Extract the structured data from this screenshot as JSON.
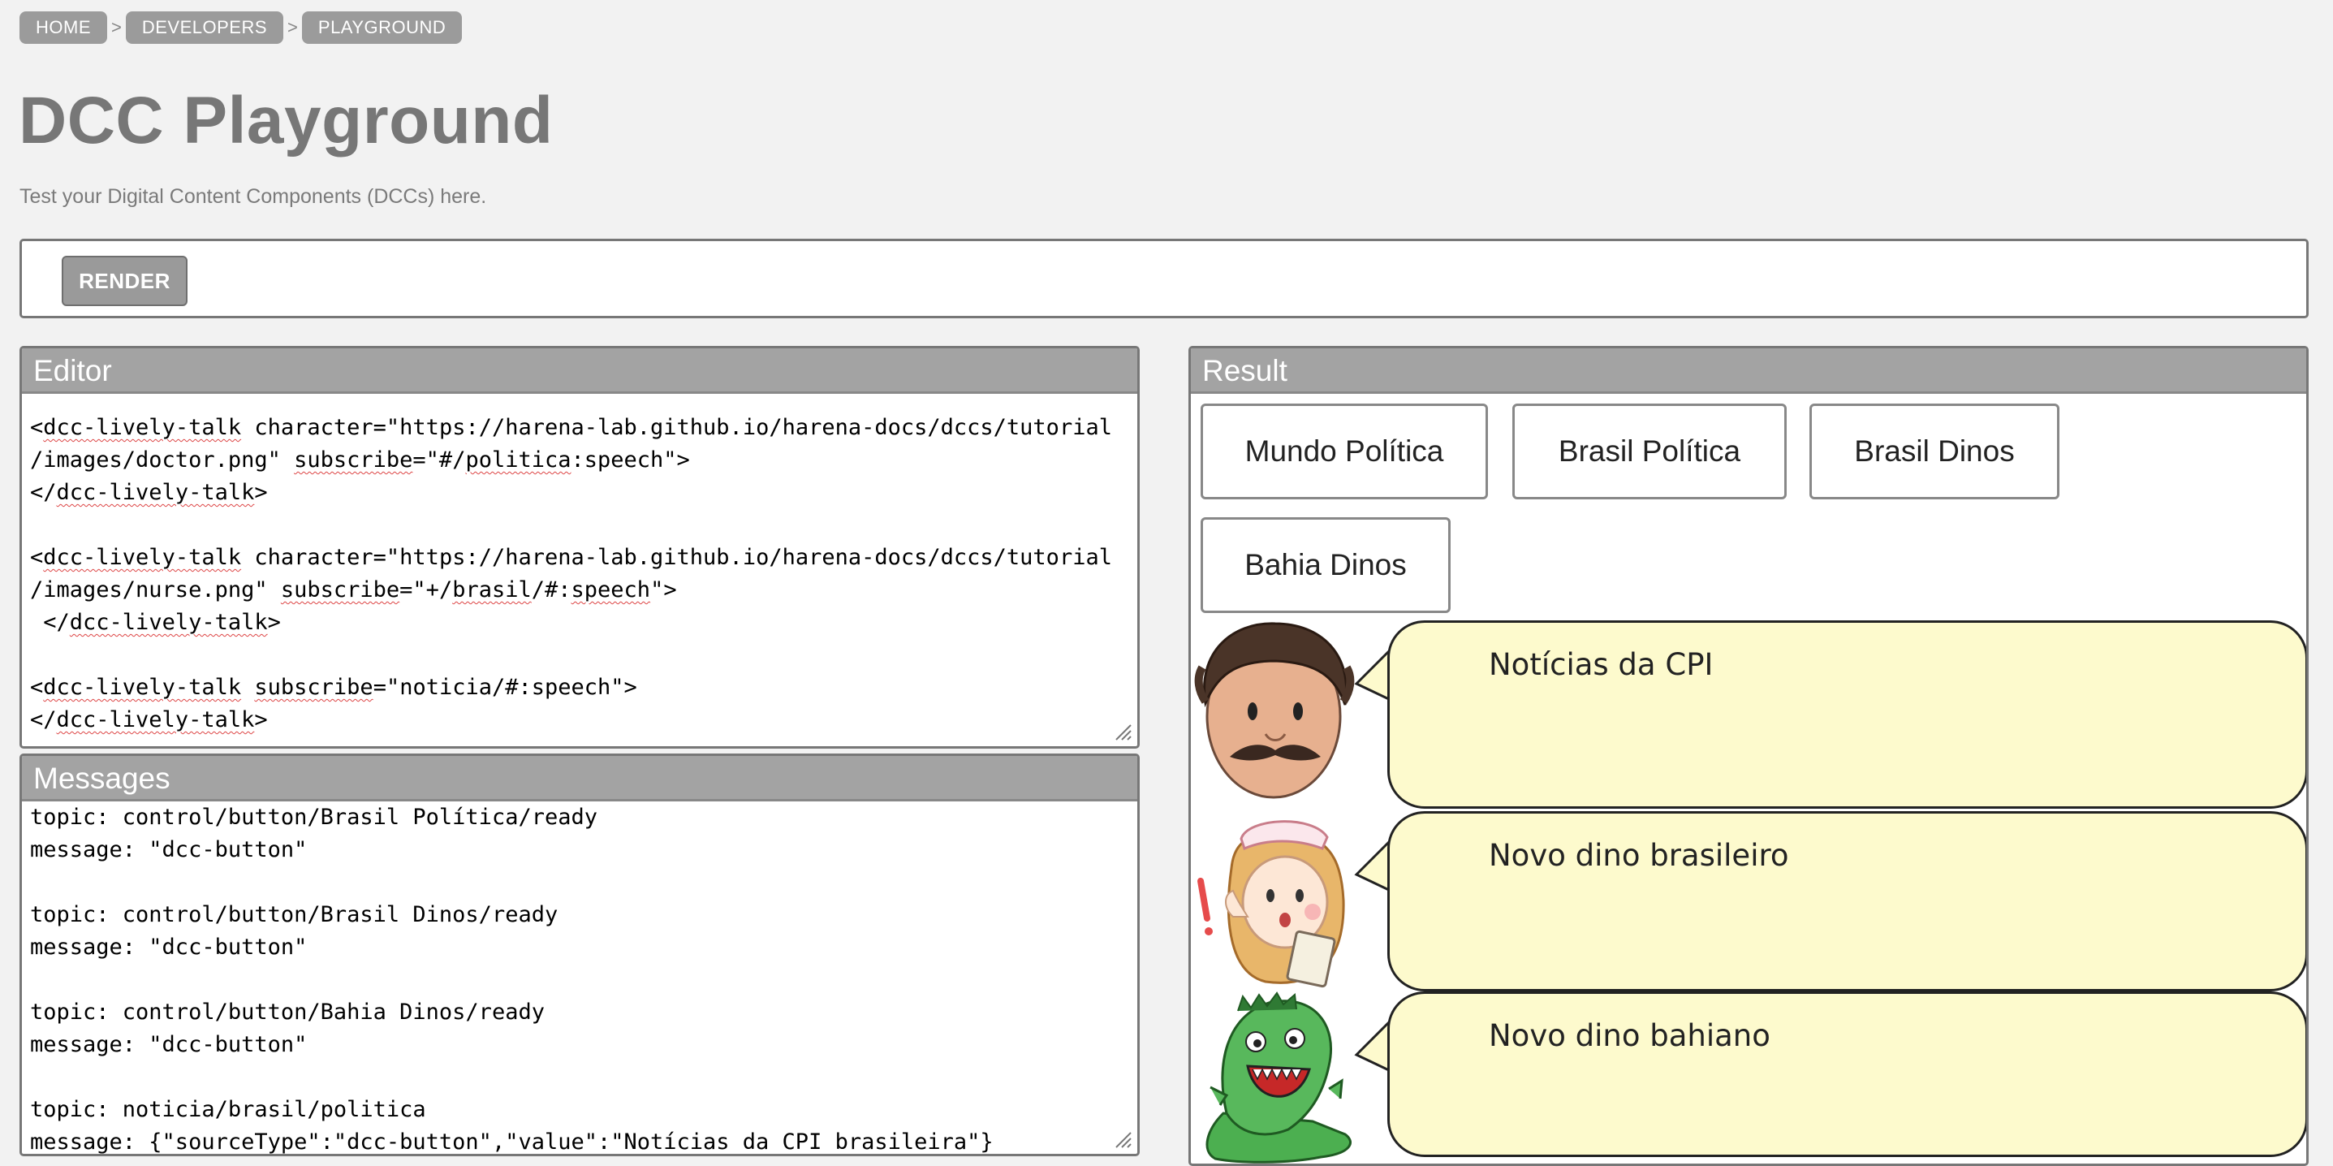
{
  "breadcrumb": [
    "HOME",
    "DEVELOPERS",
    "PLAYGROUND"
  ],
  "breadcrumb_separator": ">",
  "page": {
    "title": "DCC Playground",
    "subtitle": "Test your Digital Content Components (DCCs) here."
  },
  "toolbar": {
    "render_label": "RENDER"
  },
  "editor": {
    "title": "Editor",
    "lines": [
      "<dcc-lively-talk character=\"https://harena-lab.github.io/harena-docs/dccs/tutorial",
      "/images/doctor.png\" subscribe=\"#/politica:speech\">",
      "</dcc-lively-talk>",
      "",
      "<dcc-lively-talk character=\"https://harena-lab.github.io/harena-docs/dccs/tutorial",
      "/images/nurse.png\" subscribe=\"+/brasil/#:speech\">",
      " </dcc-lively-talk>",
      "",
      "<dcc-lively-talk subscribe=\"noticia/#:speech\">",
      "</dcc-lively-talk>"
    ]
  },
  "messages": {
    "title": "Messages",
    "lines": [
      "topic: control/button/Brasil Política/ready",
      "message: \"dcc-button\"",
      "",
      "topic: control/button/Brasil Dinos/ready",
      "message: \"dcc-button\"",
      "",
      "topic: control/button/Bahia Dinos/ready",
      "message: \"dcc-button\"",
      "",
      "topic: noticia/brasil/politica",
      "message: {\"sourceType\":\"dcc-button\",\"value\":\"Notícias da CPI brasileira\"}"
    ]
  },
  "result": {
    "title": "Result",
    "buttons": [
      "Mundo Política",
      "Brasil Política",
      "Brasil Dinos",
      "Bahia Dinos"
    ],
    "talks": [
      {
        "character": "doctor",
        "text": "Notícias da CPI"
      },
      {
        "character": "nurse",
        "text": "Novo dino brasileiro"
      },
      {
        "character": "dinosaur",
        "text": "Novo dino bahiano"
      }
    ]
  },
  "colors": {
    "background": "#f2f2f2",
    "header": "#a3a3a3",
    "crumb": "#9b9b9b",
    "bubble": "#fdfacd"
  }
}
